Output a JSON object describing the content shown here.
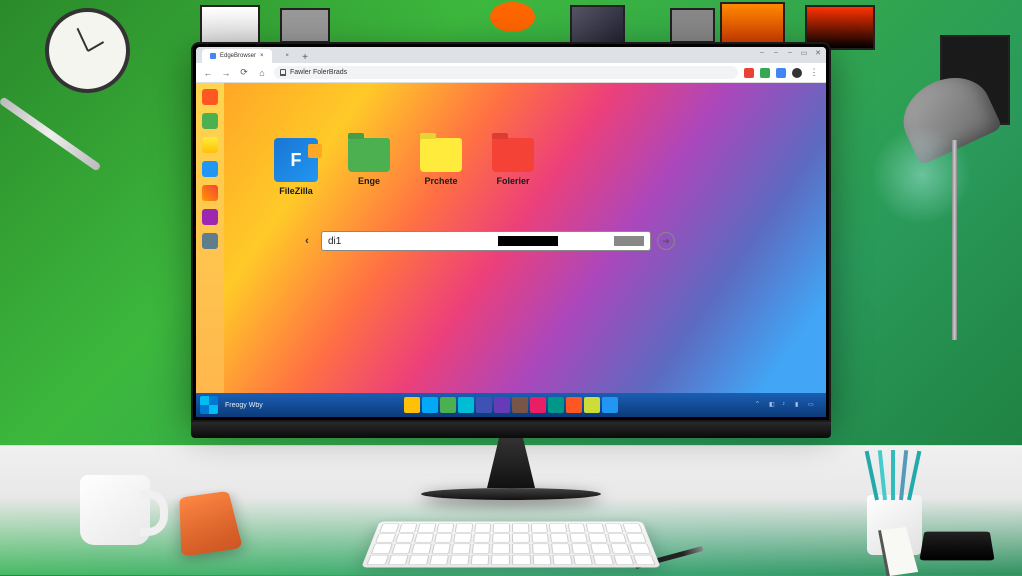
{
  "browser": {
    "tabs": [
      {
        "label": "EdgeBrowser",
        "active": true
      },
      {
        "label": "",
        "active": false
      }
    ],
    "new_tab_glyph": "+",
    "nav": {
      "back_glyph": "←",
      "forward_glyph": "→",
      "reload_glyph": "⟳",
      "home_glyph": "⌂"
    },
    "address": "Fawler  FolerBrads",
    "menu_glyph": "⋮"
  },
  "window_controls": {
    "minimize": "–",
    "maximize": "▭",
    "close": "✕"
  },
  "sidebar": {
    "items": [
      "app-1",
      "app-2",
      "app-3",
      "app-4",
      "app-5",
      "app-6",
      "app-7"
    ]
  },
  "folders": [
    {
      "label": "FileZilla",
      "type": "app",
      "color": "#1976d2"
    },
    {
      "label": "Enge",
      "type": "folder",
      "color": "#4caf50"
    },
    {
      "label": "Prchete",
      "type": "folder",
      "color": "#ffeb3b"
    },
    {
      "label": "Folerier",
      "type": "folder",
      "color": "#f44336"
    }
  ],
  "path_bar": {
    "back_glyph": "‹",
    "value": "di1",
    "go_glyph": "➜"
  },
  "taskbar": {
    "start_tooltip": "Start",
    "label": "Freogy Wby",
    "pinned_count": 12,
    "tray": {
      "icons": [
        "network",
        "sound",
        "battery",
        "lang",
        "notify"
      ]
    }
  }
}
